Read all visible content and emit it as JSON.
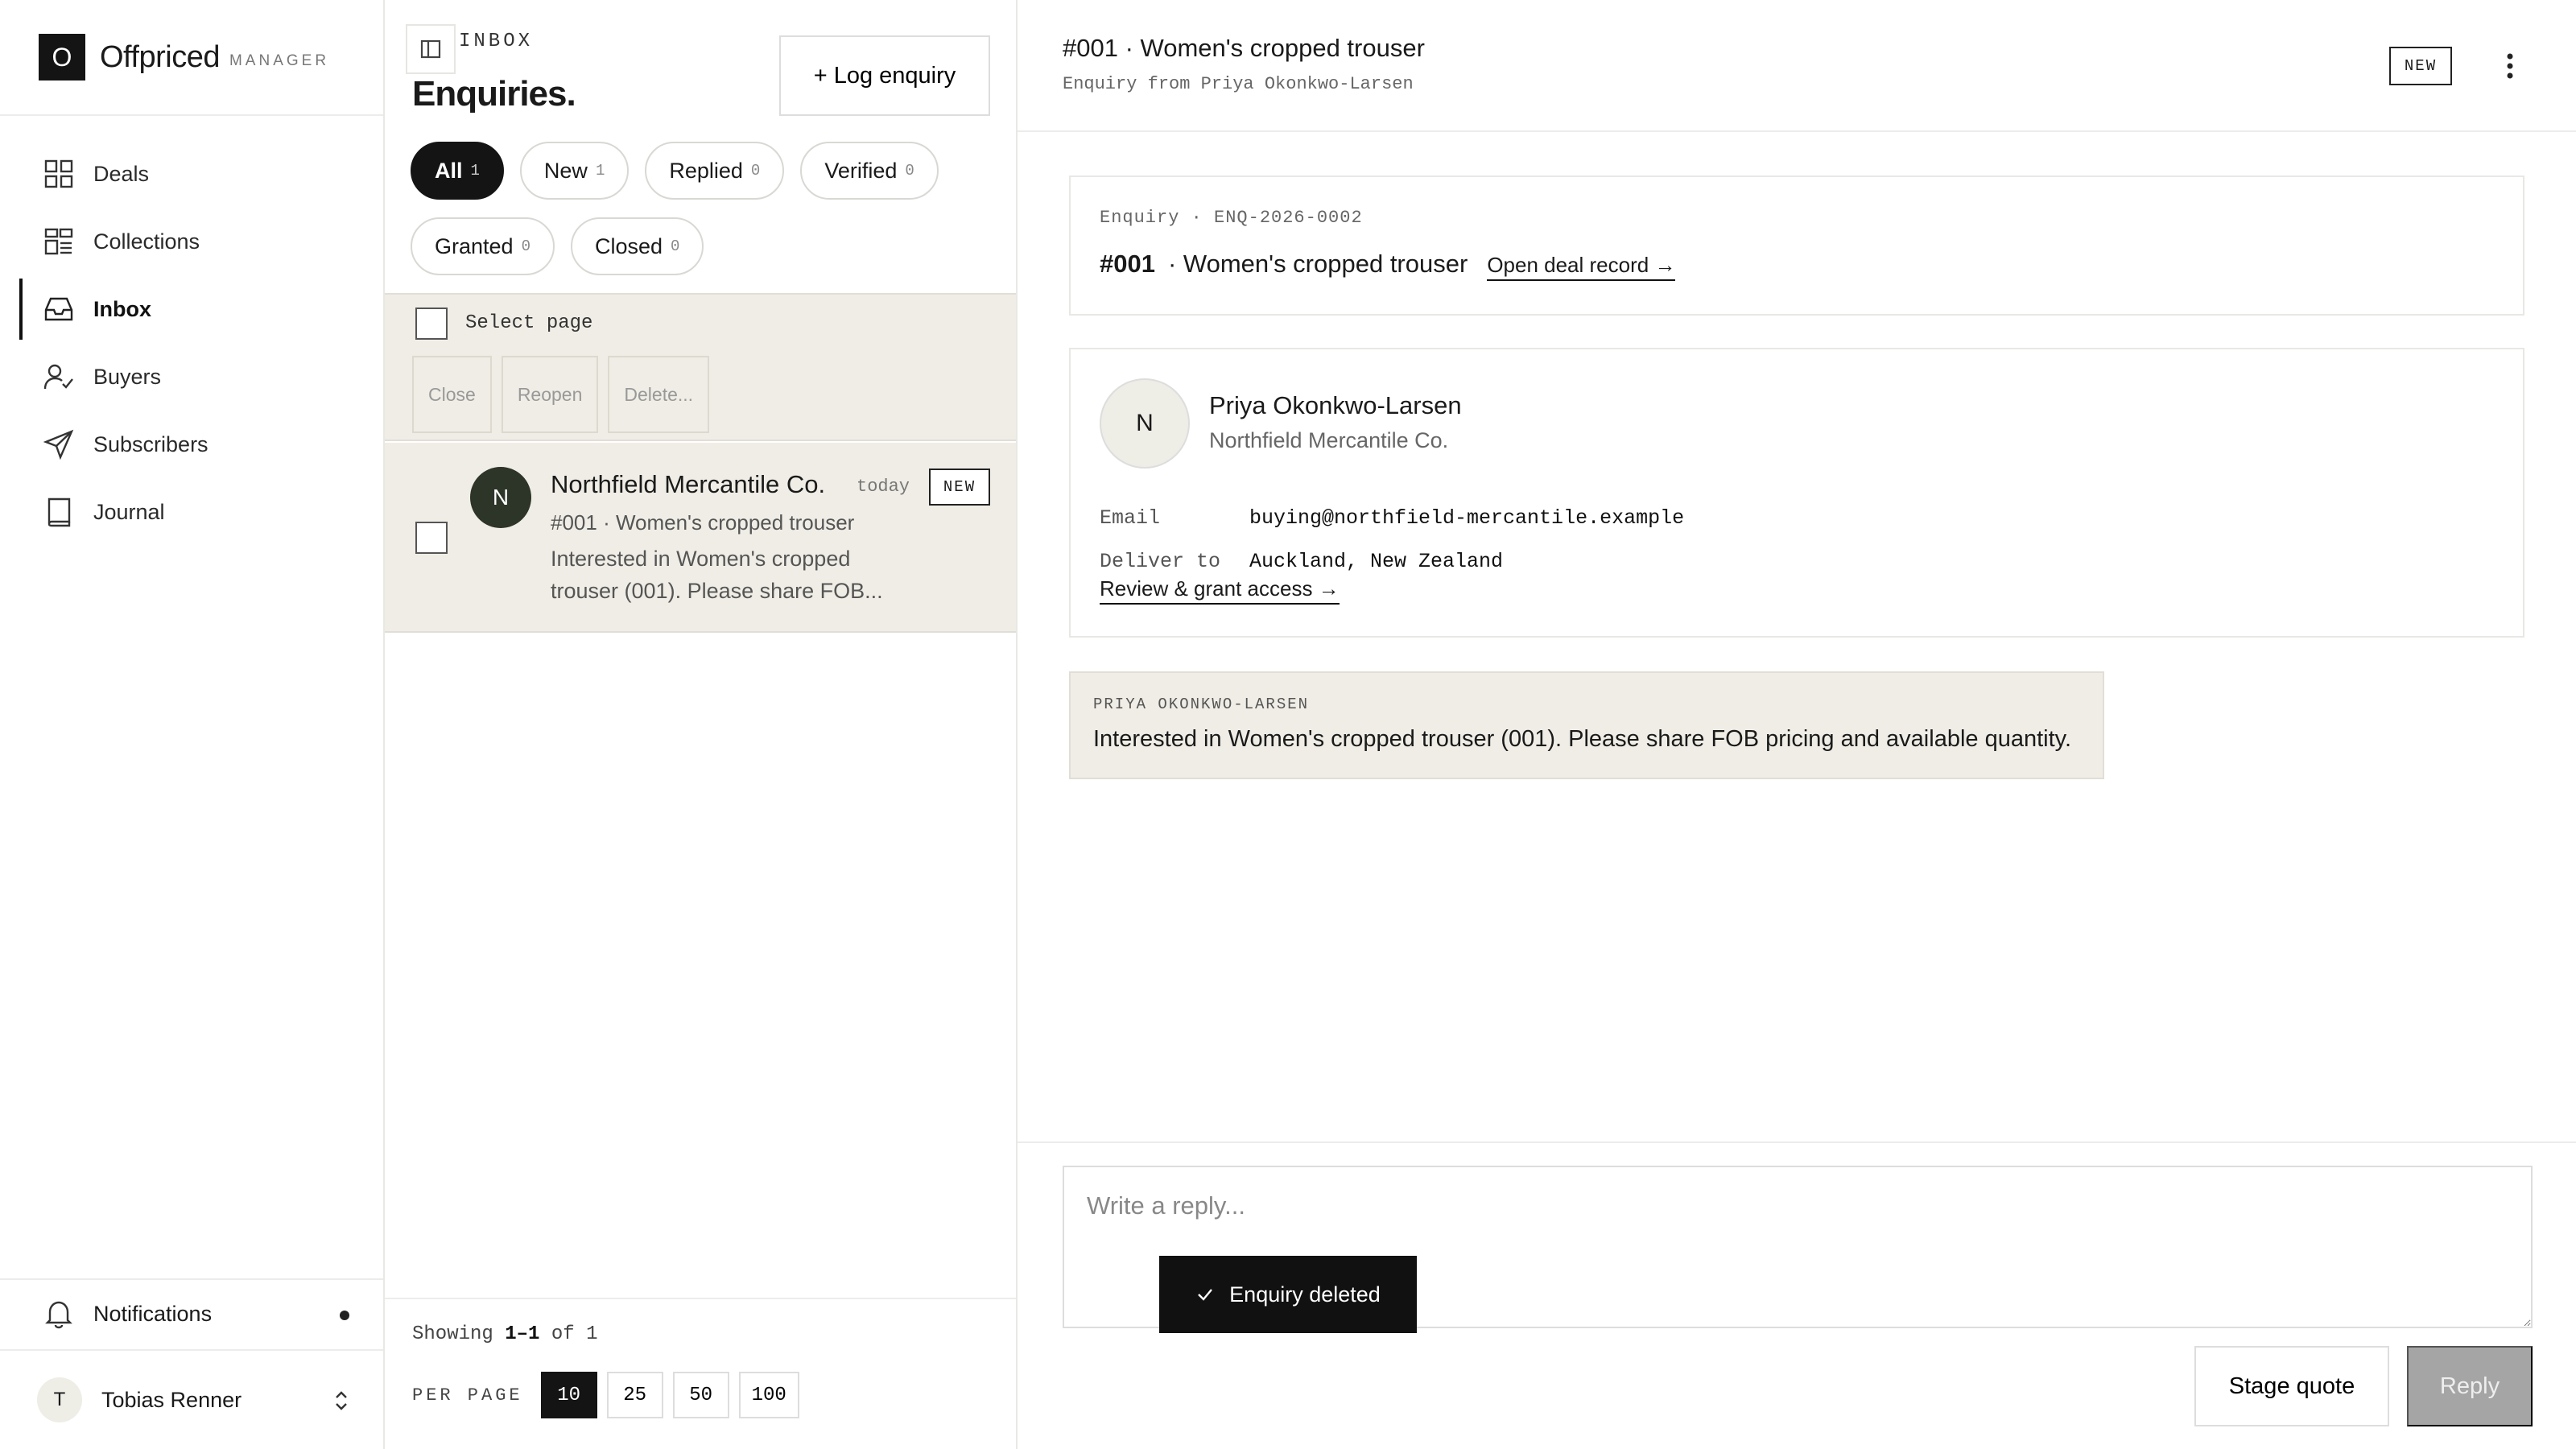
{
  "brand": {
    "logo_letter": "O",
    "name": "Offpriced",
    "subtitle": "MANAGER"
  },
  "nav": [
    {
      "label": "Deals",
      "icon": "grid-icon",
      "active": false
    },
    {
      "label": "Collections",
      "icon": "collections-icon",
      "active": false
    },
    {
      "label": "Inbox",
      "icon": "inbox-icon",
      "active": true
    },
    {
      "label": "Buyers",
      "icon": "user-check-icon",
      "active": false
    },
    {
      "label": "Subscribers",
      "icon": "send-icon",
      "active": false
    },
    {
      "label": "Journal",
      "icon": "book-icon",
      "active": false
    }
  ],
  "notifications": {
    "label": "Notifications",
    "has_unread": true
  },
  "user": {
    "initial": "T",
    "name": "Tobias Renner"
  },
  "list": {
    "section": "INBOX",
    "title": "Enquiries.",
    "log_button": "+ Log enquiry",
    "filters": [
      {
        "label": "All",
        "count": "1",
        "active": true
      },
      {
        "label": "New",
        "count": "1",
        "active": false
      },
      {
        "label": "Replied",
        "count": "0",
        "active": false
      },
      {
        "label": "Verified",
        "count": "0",
        "active": false
      },
      {
        "label": "Granted",
        "count": "0",
        "active": false
      },
      {
        "label": "Closed",
        "count": "0",
        "active": false
      }
    ],
    "select_page": "Select page",
    "bulk_actions": [
      "Close",
      "Reopen",
      "Delete..."
    ],
    "items": [
      {
        "initial": "N",
        "company": "Northfield Mercantile Co.",
        "time": "today",
        "badge": "NEW",
        "subject": "#001 · Women's cropped trouser",
        "preview": "Interested in Women's cropped trouser (001). Please share FOB..."
      }
    ],
    "footer": {
      "showing_prefix": "Showing",
      "showing_range": "1–1",
      "showing_of": "of",
      "showing_total": "1",
      "per_page_label": "PER PAGE",
      "per_page_options": [
        "10",
        "25",
        "50",
        "100"
      ],
      "per_page_selected": "10"
    }
  },
  "detail": {
    "title": "#001 · Women's cropped trouser",
    "subtitle": "Enquiry from Priya Okonkwo-Larsen",
    "badge": "NEW",
    "enquiry_meta": "Enquiry · ENQ-2026-0002",
    "deal_number": "#001",
    "deal_title": "· Women's cropped trouser",
    "open_deal_link": "Open deal record →",
    "contact": {
      "initial": "N",
      "name": "Priya Okonkwo-Larsen",
      "company": "Northfield Mercantile Co.",
      "email_label": "Email",
      "email": "buying@northfield-mercantile.example",
      "deliver_label": "Deliver to",
      "deliver_to": "Auckland, New Zealand",
      "review_link": "Review & grant access →"
    },
    "message": {
      "from": "PRIYA OKONKWO-LARSEN",
      "body": "Interested in Women's cropped trouser (001). Please share FOB pricing and available quantity."
    },
    "reply_placeholder": "Write a reply...",
    "stage_quote": "Stage quote",
    "reply_button": "Reply"
  },
  "toast": {
    "message": "Enquiry deleted"
  }
}
